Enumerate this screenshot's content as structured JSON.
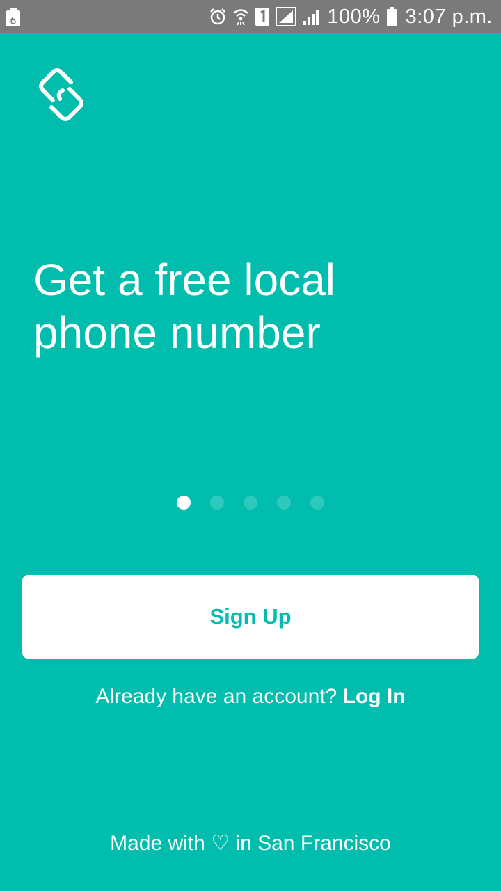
{
  "status_bar": {
    "battery_percent": "100%",
    "time": "3:07 p.m.",
    "icons": [
      "recycle-battery-icon",
      "alarm-icon",
      "wifi-icon",
      "sim-1-icon",
      "signal-icon",
      "signal-icon",
      "battery-icon"
    ]
  },
  "app": {
    "logo_icon": "linked-chain-logo-icon",
    "headline_line1": "Get a free local",
    "headline_line2": "phone number",
    "pager": {
      "count": 5,
      "active_index": 0
    },
    "signup_label": "Sign Up",
    "login_prompt": "Already have an account?",
    "login_link": "Log In",
    "footer": "Made with ♡ in San Francisco"
  },
  "colors": {
    "background": "#00BDAE",
    "status_bar": "#7A7A7A",
    "button_bg": "#FFFFFF",
    "button_text": "#00BDAE",
    "text": "#FFFFFF"
  }
}
